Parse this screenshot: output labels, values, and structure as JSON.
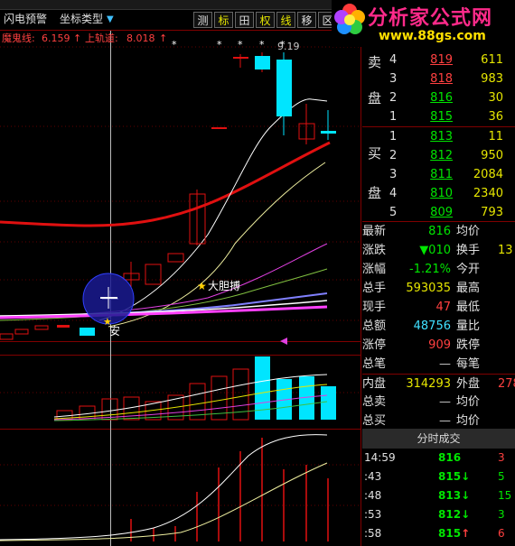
{
  "toolbar": {
    "items": [
      "闪电预警",
      "坐标类型"
    ],
    "buttons": [
      "测",
      "标",
      "田",
      "权",
      "线",
      "移",
      "区"
    ],
    "dropdown_arrow": "▼"
  },
  "indicator": {
    "name": "魔鬼线:",
    "val1": "6.159",
    "arrow1": "↑",
    "label2": "上轨道:",
    "val2": "8.018",
    "arrow2": "↑"
  },
  "chart": {
    "peak_label": "9.19",
    "star_label": "大胆搏",
    "an_label": "安",
    "star_glyph": "★",
    "dots": [
      "*",
      "*",
      "*",
      "*",
      "*"
    ]
  },
  "logo": {
    "title": "分析家公式网",
    "url": "www.88gs.com"
  },
  "quote": {
    "sell_label": [
      "卖",
      "盘"
    ],
    "buy_label": [
      "买",
      "盘"
    ],
    "sell": [
      {
        "level": "4",
        "price": "819",
        "vol": "611"
      },
      {
        "level": "3",
        "price": "818",
        "vol": "983"
      },
      {
        "level": "2",
        "price": "816",
        "vol": "30"
      },
      {
        "level": "1",
        "price": "815",
        "vol": "36"
      }
    ],
    "buy": [
      {
        "level": "1",
        "price": "813",
        "vol": "11"
      },
      {
        "level": "2",
        "price": "812",
        "vol": "950"
      },
      {
        "level": "3",
        "price": "811",
        "vol": "2084"
      },
      {
        "level": "4",
        "price": "810",
        "vol": "2340"
      },
      {
        "level": "5",
        "price": "809",
        "vol": "793"
      }
    ],
    "stats": [
      {
        "l": "最新",
        "v": "816",
        "vc": "#00e600",
        "l2": "均价",
        "v2": ""
      },
      {
        "l": "涨跌",
        "v": "▼010",
        "vc": "#00e600",
        "l2": "换手",
        "v2": "13"
      },
      {
        "l": "涨幅",
        "v": "-1.21%",
        "vc": "#00e600",
        "l2": "今开",
        "v2": ""
      },
      {
        "l": "总手",
        "v": "593035",
        "vc": "#e6e600",
        "l2": "最高",
        "v2": ""
      },
      {
        "l": "现手",
        "v": "47",
        "vc": "#ff4040",
        "l2": "最低",
        "v2": ""
      },
      {
        "l": "总额",
        "v": "48756",
        "vc": "#40e0ff",
        "l2": "量比",
        "v2": ""
      },
      {
        "l": "涨停",
        "v": "909",
        "vc": "#ff4040",
        "l2": "跌停",
        "v2": ""
      },
      {
        "l": "总笔",
        "v": "—",
        "vc": "#c8c8c8",
        "l2": "每笔",
        "v2": ""
      },
      {
        "l": "内盘",
        "v": "314293",
        "vc": "#e6e600",
        "l2": "外盘",
        "v2": "278"
      },
      {
        "l": "总卖",
        "v": "—",
        "vc": "#c8c8c8",
        "l2": "均价",
        "v2": ""
      },
      {
        "l": "总买",
        "v": "—",
        "vc": "#c8c8c8",
        "l2": "均价",
        "v2": ""
      }
    ]
  },
  "ticks": {
    "title": "分时成交",
    "rows": [
      {
        "time": "14:59",
        "price": "816",
        "arrow": "",
        "vol": "3",
        "vc": "#ff4040"
      },
      {
        "time": ":43",
        "price": "815",
        "arrow": "↓",
        "vol": "5",
        "vc": "#00e600"
      },
      {
        "time": ":48",
        "price": "813",
        "arrow": "↓",
        "vol": "15",
        "vc": "#00e600"
      },
      {
        "time": ":53",
        "price": "812",
        "arrow": "↓",
        "vol": "3",
        "vc": "#00e600"
      },
      {
        "time": ":58",
        "price": "815",
        "arrow": "↑",
        "vol": "6",
        "vc": "#ff4040"
      }
    ]
  }
}
